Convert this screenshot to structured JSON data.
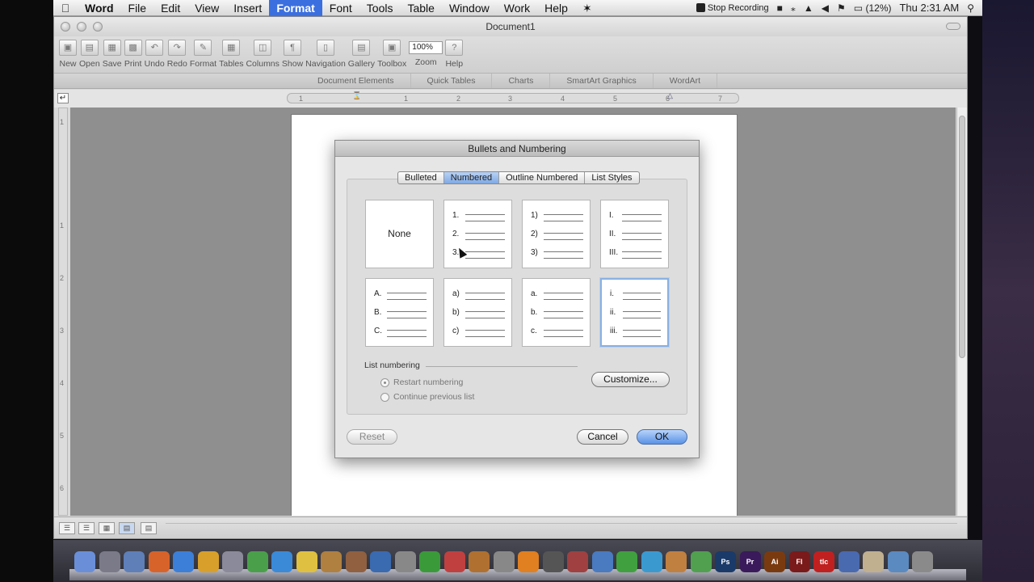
{
  "menubar": {
    "apple_icon": "apple-icon",
    "items": [
      "Word",
      "File",
      "Edit",
      "View",
      "Insert",
      "Format",
      "Font",
      "Tools",
      "Table",
      "Window",
      "Work",
      "Help"
    ],
    "active": "Format",
    "stop_recording": "Stop Recording",
    "battery": "(12%)",
    "clock": "Thu 2:31 AM"
  },
  "window": {
    "title": "Document1"
  },
  "toolbar": {
    "items": [
      {
        "label": "New",
        "icon": "new-document-icon"
      },
      {
        "label": "Open",
        "icon": "open-folder-icon"
      },
      {
        "label": "Save",
        "icon": "save-icon"
      },
      {
        "label": "Print",
        "icon": "print-icon"
      },
      {
        "label": "Undo",
        "icon": "undo-icon"
      },
      {
        "label": "Redo",
        "icon": "redo-icon"
      },
      {
        "label": "Format",
        "icon": "format-brush-icon"
      },
      {
        "label": "Tables",
        "icon": "table-icon"
      },
      {
        "label": "Columns",
        "icon": "columns-icon"
      },
      {
        "label": "Show",
        "icon": "pilcrow-icon"
      },
      {
        "label": "Navigation",
        "icon": "navigation-icon"
      },
      {
        "label": "Gallery",
        "icon": "gallery-icon"
      },
      {
        "label": "Toolbox",
        "icon": "toolbox-icon"
      }
    ],
    "zoom_value": "100%",
    "zoom_label": "Zoom",
    "help_label": "Help"
  },
  "ribbon": {
    "tabs": [
      "Document Elements",
      "Quick Tables",
      "Charts",
      "SmartArt Graphics",
      "WordArt"
    ]
  },
  "ruler": {
    "h_ticks": [
      "1",
      "1",
      "2",
      "3",
      "4",
      "5",
      "6",
      "7"
    ],
    "v_ticks": [
      "1",
      "1",
      "2",
      "3",
      "4",
      "5",
      "6"
    ]
  },
  "dialog": {
    "title": "Bullets and Numbering",
    "tabs": [
      "Bulleted",
      "Numbered",
      "Outline Numbered",
      "List Styles"
    ],
    "selected_tab": "Numbered",
    "none_label": "None",
    "styles": [
      [
        "1.",
        "2.",
        "3."
      ],
      [
        "1)",
        "2)",
        "3)"
      ],
      [
        "I.",
        "II.",
        "III."
      ],
      [
        "A.",
        "B.",
        "C."
      ],
      [
        "a)",
        "b)",
        "c)"
      ],
      [
        "a.",
        "b.",
        "c."
      ],
      [
        "i.",
        "ii.",
        "iii."
      ]
    ],
    "list_numbering_label": "List numbering",
    "restart_label": "Restart numbering",
    "continue_label": "Continue previous list",
    "customize_label": "Customize...",
    "reset_label": "Reset",
    "cancel_label": "Cancel",
    "ok_label": "OK"
  },
  "dock": {
    "icons": [
      "finder-icon",
      "system-preferences-icon",
      "preview-icon",
      "firefox-icon",
      "itunes-icon",
      "chrome-icon",
      "utility-icon",
      "evernote-icon",
      "app-store-icon",
      "stickies-icon",
      "brush-icon",
      "photo-icon",
      "quicktime-icon",
      "spider-icon",
      "chart-icon",
      "calendar-icon",
      "folder-icon",
      "usb-icon",
      "vlc-icon",
      "video-icon",
      "pen-icon",
      "browser-icon",
      "feather-icon",
      "illustrator-tool-icon",
      "hammer-icon",
      "frog-icon",
      "photoshop-icon",
      "premiere-icon",
      "illustrator-icon",
      "flash-icon",
      "tlc-icon",
      "search-globe-icon",
      "scroll-icon",
      "finder-folder-icon",
      "trash-icon"
    ],
    "labels": {
      "photoshop-icon": "Ps",
      "premiere-icon": "Pr",
      "illustrator-icon": "Ai",
      "flash-icon": "Fl",
      "tlc-icon": "tlc"
    }
  }
}
